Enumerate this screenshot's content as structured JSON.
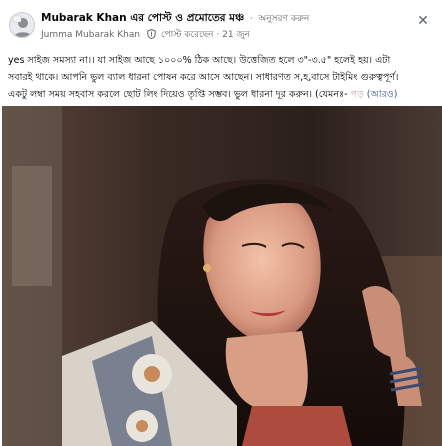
{
  "post": {
    "group_name": "Mubarak Khan এর পোস্ট ও প্রমোতের মঞ্চ",
    "follow_label": "অনুসরণ করুন",
    "author_name": "Jumma Mubarak Khan",
    "posted_label": "পোস্ট করেছেন",
    "date": "21 জুন",
    "close_icon": "close-icon",
    "text_lines": [
      "yes সাইজ সমস্যা না।। যা সাইজ আছে ১০০০% ঠিক আছে। উত্তেজিত হলে ৩\"-৩.৫\" হলেই হয়। এটা",
      "সবারই থাকে। আপনি ভুল ব্যাল ধারনা পোষন করে আসে আছেন। সাধারণত স,হ,বাসে টাইমিং গুরুত্বপূর্ণ।",
      "একটু লম্বা সময় সহবাস করলে ছোট লিং দিয়েও তৃপ্তি সম্ভব। ভুল ধারনা দূর করুন। (যেমনঃ-"
    ],
    "text_fade": "পড়",
    "see_more_label": "(আরও)"
  }
}
